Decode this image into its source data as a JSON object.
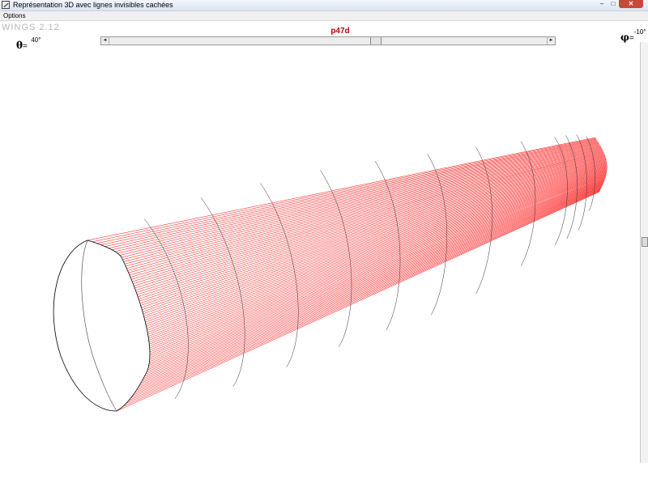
{
  "window": {
    "title": "Représentation 3D avec lignes invisibles cachées",
    "minimize_glyph": "–",
    "maximize_glyph": "□",
    "close_glyph": "✕"
  },
  "menu": {
    "items": [
      "Options"
    ]
  },
  "app_name": "WINGS 2.12",
  "theta": {
    "symbol": "θ",
    "equals": "=",
    "value": "40°"
  },
  "phi": {
    "symbol": "φ",
    "equals": "=",
    "value": "-10°"
  },
  "profile_name": "p47d",
  "scrollbar": {
    "left_arrow": "◄",
    "right_arrow": "►"
  },
  "render": {
    "wire_color": "#ff0000",
    "section_color": "#333333"
  }
}
